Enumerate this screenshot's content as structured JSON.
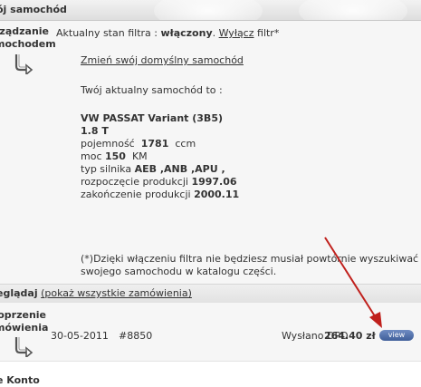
{
  "header": {
    "title": "ój samochód"
  },
  "car_panel": {
    "label_line1": "rządzanie",
    "label_line2": "mochodem",
    "filter_prefix": "Aktualny stan filtra : ",
    "filter_state": "włączony",
    "filter_toggle": "Wyłącz",
    "filter_suffix": " filtr*",
    "change_car_link": "Zmień swój domyślny samochód",
    "current_car_intro": "Twój aktualny samochód to :",
    "car_model": "VW PASSAT Variant (3B5)",
    "engine": "1.8 T",
    "capacity_label": "pojemność",
    "capacity_value": "1781",
    "capacity_unit": "ccm",
    "power_label": "moc",
    "power_value": "150",
    "power_unit": "KM",
    "engine_type_label": "typ silnika",
    "engine_type_value": "AEB ,ANB ,APU ,",
    "production_start_label": "rozpoczęcie produkcji",
    "production_start_value": "1997.06",
    "production_end_label": "zakończenie produkcji",
    "production_end_value": "2000.11",
    "note_line1": "(*)Dzięki włączeniu filtra nie będziesz musiał powtórnie wyszukiwać",
    "note_line2": "swojego samochodu w katalogu części."
  },
  "orders_bar": {
    "label": "eglądaj",
    "show_all_link": "(pokaż wszystkie zamówienia)"
  },
  "orders": {
    "label_line1": "oprzenie",
    "label_line2": "mówienia",
    "rows": [
      {
        "date": "30-05-2011",
        "number": "#8850",
        "status": "Wysłano DPD",
        "amount": "264.40 zł",
        "action": "view"
      }
    ]
  },
  "footer_section": {
    "label": "e Konto"
  },
  "colors": {
    "arrow_annotation": "#c0201c",
    "view_button": "#4a68a3",
    "panel_bg": "#f6f6f6"
  },
  "icons": {
    "curve_arrow": "curved-arrow-right-icon"
  }
}
